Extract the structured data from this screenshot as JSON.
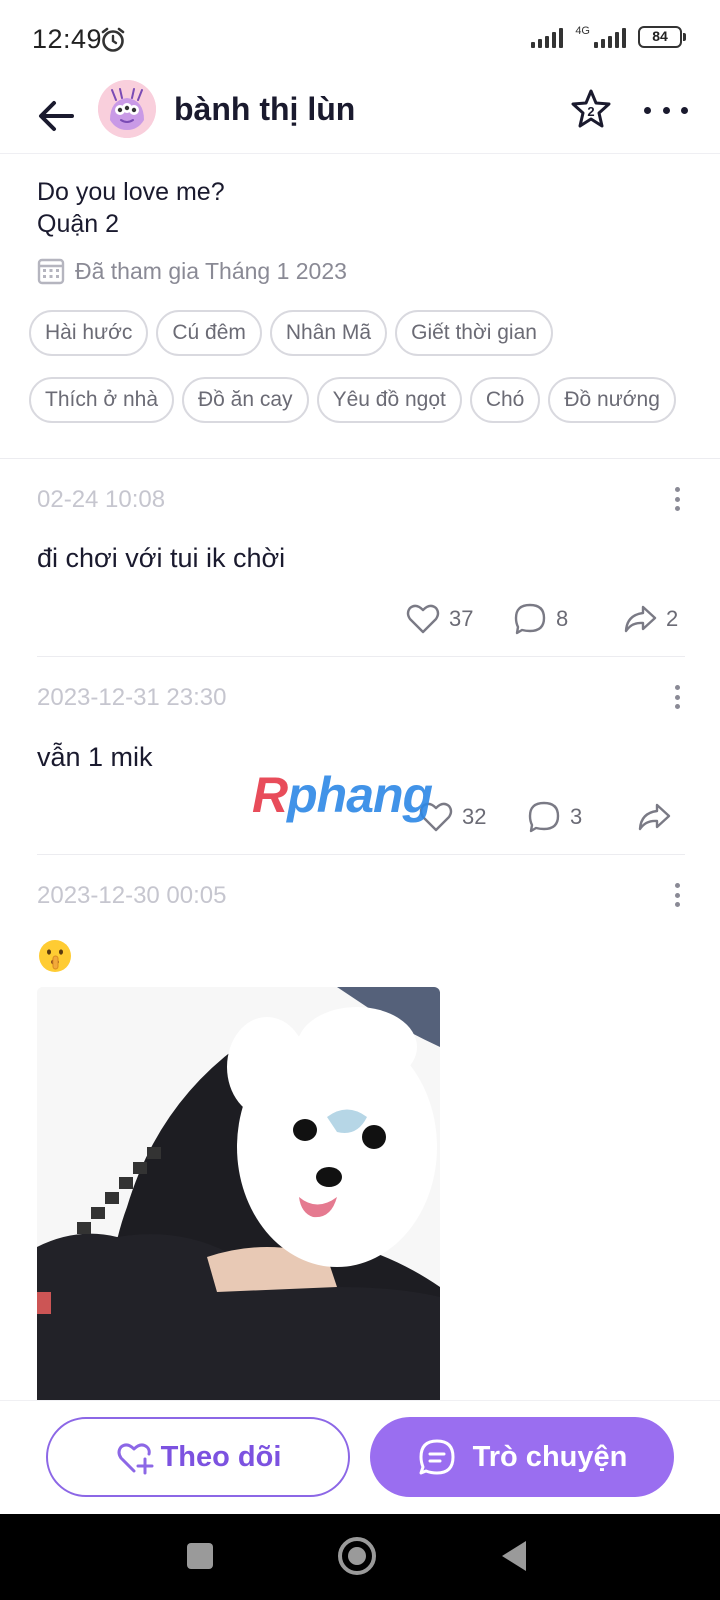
{
  "status_bar": {
    "time": "12:49",
    "network": "4G",
    "battery": "84",
    "icons": [
      "alarm-icon",
      "signal-icon",
      "signal-4g-icon",
      "battery-icon"
    ]
  },
  "header": {
    "title": "bành thị lùn",
    "star_badge": "2",
    "icons": [
      "back-arrow-icon",
      "star-icon",
      "more-icon"
    ]
  },
  "profile": {
    "bio_line1": "Do you love me?",
    "bio_line2": "Quận 2",
    "joined": "Đã tham gia Tháng 1 2023",
    "tags": [
      "Hài hước",
      "Cú đêm",
      "Nhân Mã",
      "Giết thời gian",
      "Thích ở nhà",
      "Đồ ăn cay",
      "Yêu đồ ngọt",
      "Chó",
      "Đồ nướng"
    ]
  },
  "posts": [
    {
      "date": "02-24 10:08",
      "text": "đi chơi với tui ik chời",
      "likes": "37",
      "comments": "8",
      "shares": "2"
    },
    {
      "date": "2023-12-31 23:30",
      "text": "vẫn 1 mik",
      "likes": "32",
      "comments": "3",
      "shares": ""
    },
    {
      "date": "2023-12-30 00:05",
      "emoji": "shushing-face-emoji",
      "image": "photo-dog-face-filter"
    }
  ],
  "watermark": {
    "first": "R",
    "rest": "phang"
  },
  "bottom_bar": {
    "follow_label": "Theo dõi",
    "chat_label": "Trò chuyện",
    "accent": "#9a6ef0"
  },
  "colors": {
    "text_primary": "#1a1a2e",
    "text_secondary": "#6b6b75",
    "date_gray": "#c6c6cf",
    "accent_purple": "#9a6ef0"
  }
}
